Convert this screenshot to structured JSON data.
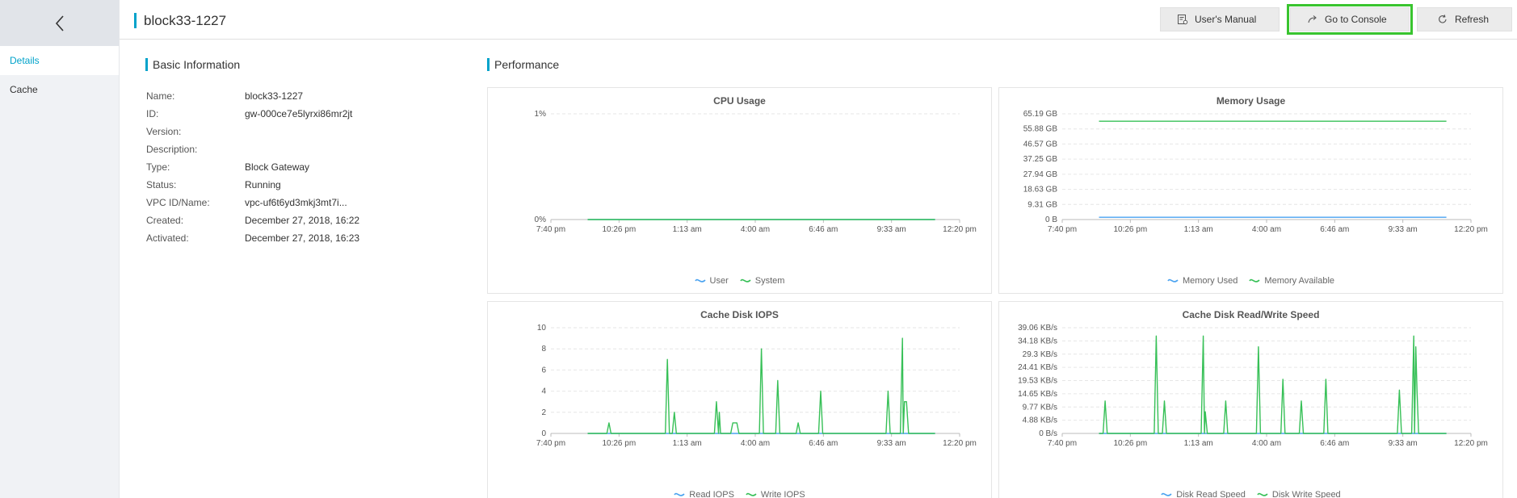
{
  "header": {
    "title": "block33-1227",
    "manual_label": "User's Manual",
    "console_label": "Go to Console",
    "refresh_label": "Refresh"
  },
  "sidebar": {
    "items": [
      {
        "label": "Details",
        "active": true
      },
      {
        "label": "Cache",
        "active": false
      }
    ]
  },
  "basic_info": {
    "title": "Basic Information",
    "rows": [
      {
        "key": "Name:",
        "value": "block33-1227"
      },
      {
        "key": "ID:",
        "value": "gw-000ce7e5lyrxi86mr2jt"
      },
      {
        "key": "Version:",
        "value": ""
      },
      {
        "key": "Description:",
        "value": ""
      },
      {
        "key": "Type:",
        "value": "Block Gateway"
      },
      {
        "key": "Status:",
        "value": "Running"
      },
      {
        "key": "VPC ID/Name:",
        "value": "vpc-uf6t6yd3mkj3mt7i..."
      },
      {
        "key": "Created:",
        "value": "December 27, 2018, 16:22"
      },
      {
        "key": "Activated:",
        "value": "December 27, 2018, 16:23"
      }
    ]
  },
  "performance": {
    "title": "Performance"
  },
  "colors": {
    "accent": "#00a2ca",
    "series_blue": "#4aa3f0",
    "series_green": "#37c057",
    "highlight": "#39c42f"
  },
  "chart_data": [
    {
      "type": "line",
      "title": "CPU Usage",
      "x_ticks": [
        "7:40 pm",
        "10:26 pm",
        "1:13 am",
        "4:00 am",
        "6:46 am",
        "9:33 am",
        "12:20 pm"
      ],
      "y_ticks": [
        "0%",
        "1%"
      ],
      "ylim": [
        0,
        1
      ],
      "series": [
        {
          "name": "User",
          "color": "#4aa3f0",
          "x": [
            0.09,
            0.94
          ],
          "y": [
            0,
            0
          ]
        },
        {
          "name": "System",
          "color": "#37c057",
          "x": [
            0.09,
            0.94
          ],
          "y": [
            0,
            0
          ]
        }
      ]
    },
    {
      "type": "line",
      "title": "Memory Usage",
      "x_ticks": [
        "7:40 pm",
        "10:26 pm",
        "1:13 am",
        "4:00 am",
        "6:46 am",
        "9:33 am",
        "12:20 pm"
      ],
      "y_ticks": [
        "0 B",
        "9.31 GB",
        "18.63 GB",
        "27.94 GB",
        "37.25 GB",
        "46.57 GB",
        "55.88 GB",
        "65.19 GB"
      ],
      "ylim": [
        0,
        65.19
      ],
      "series": [
        {
          "name": "Memory Used",
          "color": "#4aa3f0",
          "x": [
            0.09,
            0.94
          ],
          "y": [
            1.4,
            1.4
          ]
        },
        {
          "name": "Memory Available",
          "color": "#37c057",
          "x": [
            0.09,
            0.94
          ],
          "y": [
            60.6,
            60.6
          ]
        }
      ]
    },
    {
      "type": "line",
      "title": "Cache Disk IOPS",
      "x_ticks": [
        "7:40 pm",
        "10:26 pm",
        "1:13 am",
        "4:00 am",
        "6:46 am",
        "9:33 am",
        "12:20 pm"
      ],
      "y_ticks": [
        "0",
        "2",
        "4",
        "6",
        "8",
        "10"
      ],
      "ylim": [
        0,
        10
      ],
      "series": [
        {
          "name": "Read IOPS",
          "color": "#4aa3f0",
          "x": [
            0.09,
            0.94
          ],
          "y": [
            0,
            0
          ]
        },
        {
          "name": "Write IOPS",
          "color": "#37c057",
          "x": [
            0.09,
            0.137,
            0.142,
            0.147,
            0.28,
            0.285,
            0.29,
            0.297,
            0.302,
            0.307,
            0.4,
            0.405,
            0.41,
            0.412,
            0.415,
            0.44,
            0.445,
            0.45,
            0.455,
            0.46,
            0.51,
            0.515,
            0.52,
            0.55,
            0.555,
            0.56,
            0.6,
            0.605,
            0.61,
            0.655,
            0.66,
            0.665,
            0.82,
            0.825,
            0.83,
            0.855,
            0.86,
            0.862,
            0.865,
            0.87,
            0.875,
            0.94
          ],
          "y": [
            0,
            0,
            1,
            0,
            0,
            7,
            0,
            0,
            2,
            0,
            0,
            3,
            0,
            2,
            0,
            0,
            1,
            1,
            1,
            0,
            0,
            8,
            0,
            0,
            5,
            0,
            0,
            1,
            0,
            0,
            4,
            0,
            0,
            4,
            0,
            0,
            9,
            0,
            3,
            3,
            0,
            0
          ]
        }
      ]
    },
    {
      "type": "line",
      "title": "Cache Disk Read/Write Speed",
      "x_ticks": [
        "7:40 pm",
        "10:26 pm",
        "1:13 am",
        "4:00 am",
        "6:46 am",
        "9:33 am",
        "12:20 pm"
      ],
      "y_ticks": [
        "0 B/s",
        "4.88 KB/s",
        "9.77 KB/s",
        "14.65 KB/s",
        "19.53 KB/s",
        "24.41 KB/s",
        "29.3 KB/s",
        "34.18 KB/s",
        "39.06 KB/s"
      ],
      "ylim": [
        0,
        39.06
      ],
      "series": [
        {
          "name": "Disk Read Speed",
          "color": "#4aa3f0",
          "x": [
            0.09,
            0.94
          ],
          "y": [
            0,
            0
          ]
        },
        {
          "name": "Disk Write Speed",
          "color": "#37c057",
          "x": [
            0.09,
            0.1,
            0.105,
            0.11,
            0.225,
            0.23,
            0.235,
            0.245,
            0.25,
            0.255,
            0.34,
            0.345,
            0.348,
            0.35,
            0.355,
            0.395,
            0.4,
            0.405,
            0.475,
            0.48,
            0.485,
            0.535,
            0.54,
            0.545,
            0.58,
            0.585,
            0.59,
            0.64,
            0.645,
            0.65,
            0.82,
            0.825,
            0.83,
            0.855,
            0.86,
            0.862,
            0.865,
            0.868,
            0.872,
            0.94
          ],
          "y": [
            0,
            0,
            12,
            0,
            0,
            36,
            0,
            0,
            12,
            0,
            0,
            36,
            0,
            8,
            0,
            0,
            12,
            0,
            0,
            32,
            0,
            0,
            20,
            0,
            0,
            12,
            0,
            0,
            20,
            0,
            0,
            16,
            0,
            0,
            36,
            0,
            32,
            16,
            0,
            0
          ]
        }
      ]
    }
  ]
}
